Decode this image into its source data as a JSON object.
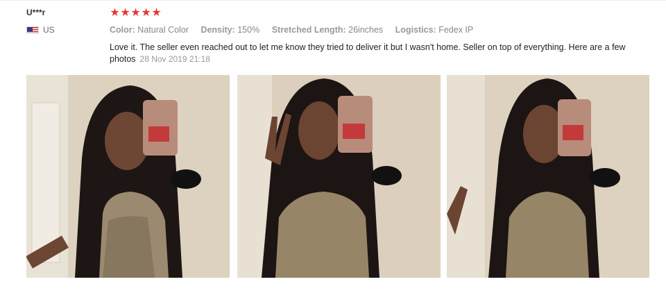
{
  "review": {
    "user": "U***r",
    "country": "US",
    "rating": 5,
    "stars": [
      "★",
      "★",
      "★",
      "★",
      "★"
    ],
    "attributes": [
      {
        "label": "Color:",
        "value": "Natural Color"
      },
      {
        "label": "Density:",
        "value": "150%"
      },
      {
        "label": "Stretched Length:",
        "value": "26inches"
      },
      {
        "label": "Logistics:",
        "value": "Fedex IP"
      }
    ],
    "text": "Love it. The seller even reached out to let me know they tried to deliver it but I wasn't home. Seller on top of everything. Here are a few photos",
    "date": "28 Nov 2019 21:18"
  },
  "colors": {
    "star": "#e53935",
    "label": "#999999",
    "text": "#222222",
    "muted": "#888888"
  }
}
